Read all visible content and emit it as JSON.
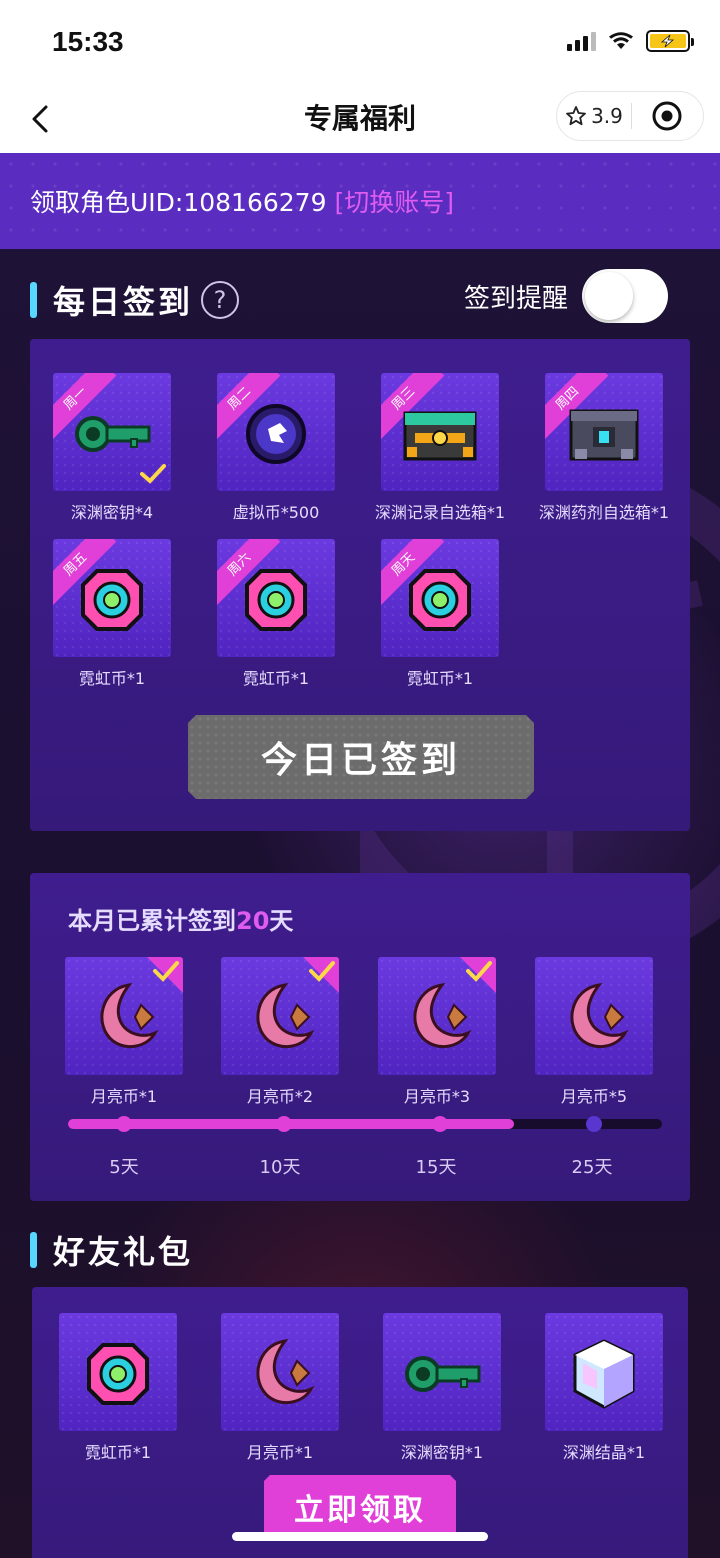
{
  "status_bar": {
    "time": "15:33"
  },
  "nav": {
    "title": "专属福利",
    "rating": "3.9"
  },
  "uid_bar": {
    "label": "领取角色UID:108166279",
    "switch_text": "[切换账号]"
  },
  "daily_checkin": {
    "title": "每日签到",
    "help_symbol": "?",
    "reminder_label": "签到提醒",
    "reminder_on": false,
    "items": [
      {
        "day": "周一",
        "label": "深渊密钥*4",
        "icon": "abyss-key",
        "claimed": true
      },
      {
        "day": "周二",
        "label": "虚拟币*500",
        "icon": "virtual-coin",
        "claimed": false
      },
      {
        "day": "周三",
        "label": "深渊记录自选箱*1",
        "icon": "record-chest",
        "claimed": false
      },
      {
        "day": "周四",
        "label": "深渊药剂自选箱*1",
        "icon": "potion-chest",
        "claimed": false
      },
      {
        "day": "周五",
        "label": "霓虹币*1",
        "icon": "neon-coin",
        "claimed": false
      },
      {
        "day": "周六",
        "label": "霓虹币*1",
        "icon": "neon-coin",
        "claimed": false
      },
      {
        "day": "周天",
        "label": "霓虹币*1",
        "icon": "neon-coin",
        "claimed": false
      }
    ],
    "button_label": "今日已签到"
  },
  "monthly": {
    "title_prefix": "本月已累计签到",
    "days": "20",
    "title_suffix": "天",
    "progress_fraction": 0.75,
    "rewards": [
      {
        "label": "月亮币*1",
        "icon": "moon-coin",
        "milestone": "5天",
        "claimed": true
      },
      {
        "label": "月亮币*2",
        "icon": "moon-coin",
        "milestone": "10天",
        "claimed": true
      },
      {
        "label": "月亮币*3",
        "icon": "moon-coin",
        "milestone": "15天",
        "claimed": true
      },
      {
        "label": "月亮币*5",
        "icon": "moon-coin",
        "milestone": "25天",
        "claimed": false
      }
    ]
  },
  "friend_gift": {
    "title": "好友礼包",
    "items": [
      {
        "label": "霓虹币*1",
        "icon": "neon-coin"
      },
      {
        "label": "月亮币*1",
        "icon": "moon-coin"
      },
      {
        "label": "深渊密钥*1",
        "icon": "abyss-key"
      },
      {
        "label": "深渊结晶*1",
        "icon": "abyss-crystal"
      }
    ],
    "button_label": "立即领取"
  },
  "colors": {
    "accent_pink": "#e040d8",
    "accent_cyan": "#57d6ff",
    "panel_purple": "#3f1d8e"
  }
}
